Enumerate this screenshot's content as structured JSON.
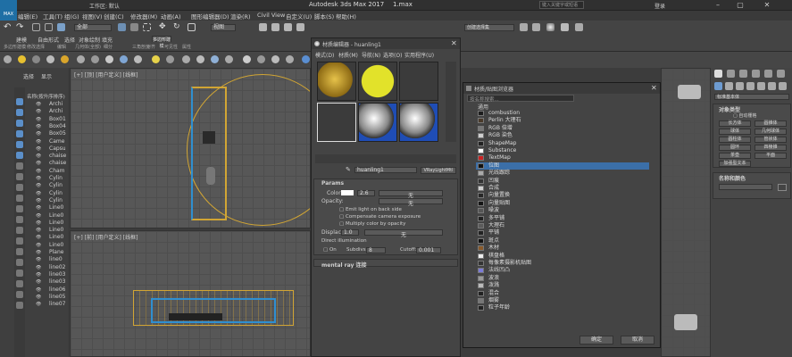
{
  "titlebar": {
    "app_title": "Autodesk 3ds Max 2017",
    "file_name": "1.max",
    "workspace_label": "工作区: 默认",
    "search_placeholder": "键入关键字或短语",
    "login_label": "登录",
    "max_badge": "MAX"
  },
  "menu": {
    "items": [
      "编辑(E)",
      "工具(T)",
      "组(G)",
      "视图(V)",
      "创建(C)",
      "修改器(M)",
      "动画(A)",
      "图形编辑器(D)",
      "渲染(R)",
      "Civil View",
      "自定义(U)",
      "脚本(S)",
      "帮助(H)"
    ]
  },
  "toolbar1": {
    "select_filter": "全部",
    "view_dropdown": "视图",
    "selection_set": "创建选择集"
  },
  "ribbon": {
    "tabs": [
      "建模",
      "自由形式",
      "选择",
      "对象绘制",
      "填充"
    ],
    "subtabs": [
      "多边形建模",
      "修改选择",
      "编辑",
      "几何体(全部)",
      "细分",
      "三角剖分",
      "对齐",
      "可见性",
      "属性"
    ],
    "poly_label": "多边形建模"
  },
  "left_panel": {
    "tabs": [
      "选择",
      "显示"
    ],
    "header": "名称(按升序排序)",
    "items": [
      "Archi",
      "Archi",
      "Box01",
      "Box04",
      "Box05",
      "Came",
      "Capsu",
      "chaise",
      "chaise",
      "Cham",
      "Cylin",
      "Cylin",
      "Cylin",
      "Cylin",
      "Line0",
      "Line0",
      "Line0",
      "Line0",
      "Line0",
      "Line0",
      "Plane",
      "line0",
      "line02",
      "line03",
      "line03",
      "line06",
      "line05",
      "line07"
    ]
  },
  "viewports": {
    "top_left": "[+] [顶] [用户定义] [线框]",
    "bottom_left": "[+] [前] [用户定义] [线框]",
    "top_right": "[+] [透视] [用户定义] [默认明暗处理]"
  },
  "material_editor": {
    "title": "材质编辑器 - huanling1",
    "menu": [
      "模式(D)",
      "材质(M)",
      "导航(N)",
      "选项(O)",
      "实用程序(U)"
    ],
    "material_name": "huanling1",
    "material_type": "VRayLightMtl",
    "params_header": "Params",
    "color_label": "Color:",
    "color_value": "2.6",
    "none_label": "无",
    "opacity_label": "Opacity:",
    "emit_back": "Emit light on back side",
    "compensate": "Compensate camera exposure",
    "multiply": "Multiply color by opacity",
    "displace_label": "Displace:",
    "displace_value": "1.0",
    "direct_label": "Direct illumination",
    "on_label": "On",
    "subdivs_label": "Subdivs:",
    "subdivs_value": "8",
    "cutoff_label": "Cutoff:",
    "cutoff_value": "0.001",
    "mental_ray": "mental ray 连接"
  },
  "browser": {
    "title": "材质/贴图浏览器",
    "search_placeholder": "按名称搜索...",
    "group_header": "通用",
    "items": [
      "combustion",
      "Perlin 大理石",
      "RGB 倍增",
      "RGB 染色",
      "ShapeMap",
      "Substance",
      "TextMap",
      "位图",
      "光线跟踪",
      "凹痕",
      "合成",
      "向量置换",
      "向量贴图",
      "噪波",
      "多平铺",
      "大理石",
      "平铺",
      "斑点",
      "木材",
      "棋盘格",
      "每像素摄影机贴图",
      "法线凹凸",
      "波浪",
      "泼溅",
      "混合",
      "烟雾",
      "粒子年龄"
    ],
    "selected_index": 7,
    "ok_button": "确定",
    "cancel_button": "取消"
  },
  "right_panel": {
    "object_types_header": "对象类型",
    "auto_grid": "自动栅格",
    "buttons": [
      "长方体",
      "圆锥体",
      "球体",
      "几何球体",
      "圆柱体",
      "管状体",
      "圆环",
      "四棱锥",
      "茶壶",
      "平面",
      "加强型文本"
    ],
    "name_color_header": "名称和颜色",
    "std_primitives": "标准基本体"
  },
  "colors": {
    "accent": "#3b6fa8",
    "yellow_sphere": "#e2e22a",
    "wire_yellow": "#d1a534",
    "wire_blue": "#2f8fd0",
    "selected": "#3b6fa8"
  }
}
